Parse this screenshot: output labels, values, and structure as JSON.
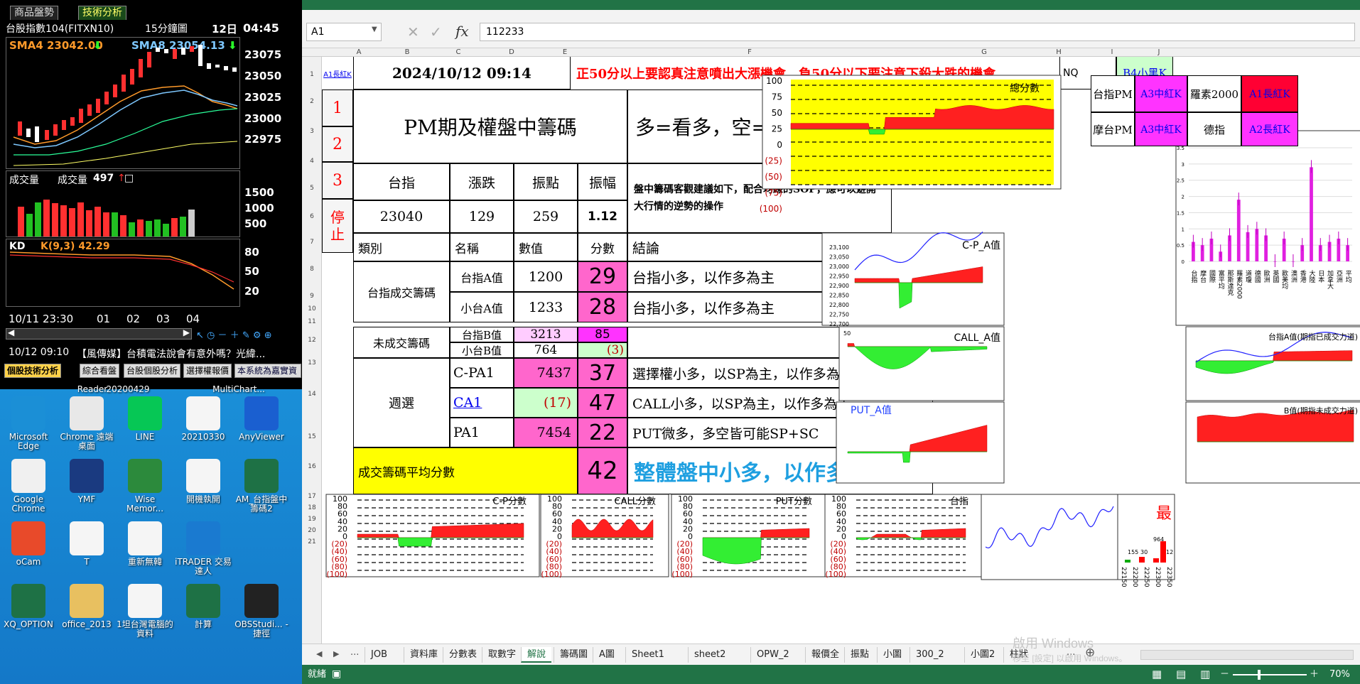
{
  "trade": {
    "tab1": "商品盤勢",
    "tab2": "技術分析",
    "symbol": "台股指數104(FITXN10)",
    "period": "15分鐘圖",
    "day": "12日",
    "time": "04:45",
    "sma4_label": "SMA4 23042.00",
    "sma8_label": "SMA8 23054.13",
    "price_axis": [
      "23075",
      "23050",
      "23025",
      "23000",
      "22975"
    ],
    "volume_label": "成交量",
    "volume_value_label": "成交量",
    "volume_value": "497",
    "volume_axis": [
      "1500",
      "1000",
      "500"
    ],
    "kd_label": "KD",
    "kd_value": "K(9,3) 42.29",
    "kd_axis": [
      "80",
      "50",
      "20"
    ],
    "time_axis": [
      "10/11 23:30",
      "01",
      "02",
      "03",
      "04"
    ],
    "news_time": "10/12 09:10",
    "news_text": "【風傳媒】台積電法說會有意外嗎？光緯...",
    "btabs": [
      "個股技術分析",
      "綜合看盤",
      "台股個股分析",
      "選擇權報價",
      "本系統為嘉實資"
    ]
  },
  "desktop": {
    "icons": [
      {
        "label": "Microsoft Edge",
        "color": "#1b8fd6"
      },
      {
        "label": "Chrome 遠端桌面",
        "color": "#e8e8e8"
      },
      {
        "label": "LINE",
        "color": "#06c755"
      },
      {
        "label": "20210330",
        "color": "#f5f5f5"
      },
      {
        "label": "AnyViewer",
        "color": "#1a5fd0"
      },
      {
        "label": "Google Chrome",
        "color": "#f0f0f0"
      },
      {
        "label": "YMF",
        "color": "#1a3a80"
      },
      {
        "label": "Wise Memor...",
        "color": "#2c8a3c"
      },
      {
        "label": "開機執開",
        "color": "#f5f5f5"
      },
      {
        "label": "AM_台指盤中籌碼2",
        "color": "#1e7145"
      },
      {
        "label": "oCam",
        "color": "#e84a2a"
      },
      {
        "label": "T",
        "color": "#f5f5f5"
      },
      {
        "label": "重新無韓",
        "color": "#f5f5f5"
      },
      {
        "label": "iTRADER 交易達人",
        "color": "#1a7ad0"
      },
      {
        "label": "",
        "color": "#1a8fd8"
      },
      {
        "label": "XQ_OPTION",
        "color": "#1e7145"
      },
      {
        "label": "office_2013",
        "color": "#e8c060"
      },
      {
        "label": "1坦台灣電腦的資料",
        "color": "#f5f5f5"
      },
      {
        "label": "計算",
        "color": "#1e7145"
      },
      {
        "label": "OBSStudi... - 捷徑",
        "color": "#222222"
      }
    ],
    "top_labels": [
      "Reader",
      "20200429",
      "MultiChart..."
    ]
  },
  "excel": {
    "namebox": "A1",
    "formula": "112233",
    "cols": [
      "A",
      "B",
      "C",
      "D",
      "E",
      "F",
      "G",
      "H",
      "I",
      "J"
    ],
    "rows": [
      "1",
      "2",
      "3",
      "4",
      "5",
      "6",
      "7",
      "8",
      "9",
      "10",
      "11",
      "12",
      "13",
      "14",
      "15",
      "16",
      "17",
      "18",
      "19",
      "20",
      "21"
    ],
    "cells": {
      "a1": "A1長紅K",
      "datetime": "2024/10/12 09:14",
      "headline": "正50分以上要認真注意噴出大漲機會，負50分以下要注意下殺大跌的機會",
      "nq": "NQ",
      "b4": "B4小黑K",
      "n1": "1",
      "n2": "2",
      "n3": "3",
      "stop": "停止",
      "pm_title": "PM期及權盤中籌碼",
      "duo": "多=看多，空=看空",
      "h_taizhi": "台指",
      "h_zhangdie": "漲跌",
      "h_zhendian": "振點",
      "h_zhenfu": "振幅",
      "v_taizhi": "23040",
      "v_zhangdie": "129",
      "v_zhendian": "259",
      "v_zhenfu": "1.12",
      "advice": "盤中籌碼客觀建議如下，配合均線的SOP，應可以避開大行情的逆勢的操作",
      "leibie": "類別",
      "mingcheng": "名稱",
      "shuzhi": "數值",
      "fenshu": "分數",
      "jielun": "結論",
      "taizhi_chengjiao": "台指成交籌碼",
      "taizhi_a": "台指A值",
      "taizhi_a_v": "1200",
      "taizhi_a_s": "29",
      "taizhi_a_c": "台指小多，以作多為主",
      "xiaotai_a": "小台A值",
      "xiaotai_a_v": "1233",
      "xiaotai_a_s": "28",
      "xiaotai_a_c": "台指小多，以作多為主",
      "weichengjiao": "未成交籌碼",
      "taizhi_b": "台指B值",
      "taizhi_b_v": "3213",
      "taizhi_b_s": "85",
      "xiaotai_b": "小台B值",
      "xiaotai_b_v": "764",
      "xiaotai_b_s": "(3)",
      "zhouxuan": "週選",
      "cpa1": "C-PA1",
      "cpa1_v": "7437",
      "cpa1_s": "37",
      "cpa1_c": "選擇權小多，以SP為主，以作多為主",
      "ca1": "CA1",
      "ca1_v": "(17)",
      "ca1_s": "47",
      "ca1_c": "CALL小多，以SP為主，以作多為主",
      "pa1": "PA1",
      "pa1_v": "7454",
      "pa1_s": "22",
      "pa1_c": "PUT微多，多空皆可能SP+SC",
      "avg_label": "成交籌碼平均分數",
      "avg_v": "42",
      "overall": "整體盤中小多，以作多為主",
      "taizhi_pm": "台指PM",
      "a3_1": "A3中紅K",
      "luosu": "羅素2000",
      "motai_pm": "摩台PM",
      "a3_2": "A3中紅K",
      "dezhi": "德指",
      "a2": "A2長紅K"
    },
    "charts": {
      "score": {
        "title": "總分數",
        "axis": [
          "100",
          "75",
          "50",
          "25",
          "0",
          "(25)",
          "(50)",
          "(75)",
          "(100)"
        ]
      },
      "cpa": {
        "title": "C-P_A值",
        "axis": [
          "23,100",
          "23,050",
          "23,000",
          "22,950",
          "22,900",
          "22,850",
          "22,800",
          "22,750",
          "22,700"
        ]
      },
      "calla": {
        "title": "CALL_A值",
        "axis": [
          "50"
        ]
      },
      "puta": {
        "title": "PUT_A值"
      },
      "taizhia": {
        "title": "台指A值(期指已成交力道)"
      },
      "bval": {
        "title": "B值(期指未成交力道)"
      },
      "cpscore": {
        "title": "C-P分數"
      },
      "callscore": {
        "title": "CALL分數"
      },
      "putscore": {
        "title": "PUT分數"
      },
      "taizhi2": {
        "title": "台指"
      },
      "zui": {
        "title": "最"
      },
      "score_axis": [
        "100",
        "80",
        "60",
        "40",
        "20",
        "0",
        "(20)",
        "(40)",
        "(60)",
        "(80)",
        "(100)"
      ],
      "bar_axis": [
        "3.5",
        "3",
        "2.5",
        "2",
        "1.5",
        "1",
        "0.5",
        "0"
      ],
      "bar_labels": [
        "台指",
        "摩台",
        "國際",
        "富平均",
        "那斯達克",
        "羅素2000",
        "道瓊",
        "德國",
        "歐洲",
        "英國",
        "歐美均",
        "澳洲",
        "香港",
        "大陸",
        "日本",
        "加拿大",
        "亞洲",
        "平均"
      ],
      "bar_values": [
        0.6,
        0.5,
        0.7,
        0.3,
        0.8,
        1.9,
        0.9,
        1.0,
        0.8,
        0.0,
        0.7,
        0.0,
        0.5,
        2.9,
        0.5,
        0.6,
        0.7,
        0.5
      ],
      "small_bar_labels": [
        "22150",
        "22200",
        "22250",
        "22300",
        "22350"
      ],
      "small_bar_values": [
        "155",
        "30",
        "964",
        "12"
      ]
    },
    "sheet_tabs": [
      "JOB",
      "資料庫",
      "分數表",
      "取數字",
      "解說",
      "籌碼圖",
      "A圖",
      "Sheet1",
      "sheet2",
      "OPW_2",
      "報價全",
      "振點",
      "小圖",
      "300_2",
      "小圖2",
      "柱狀"
    ],
    "active_tab": "解說",
    "status": "就緒",
    "zoom": "70%",
    "watermark1": "啟用 Windows",
    "watermark2": "移至 [設定] 以啟用 Windows。"
  }
}
